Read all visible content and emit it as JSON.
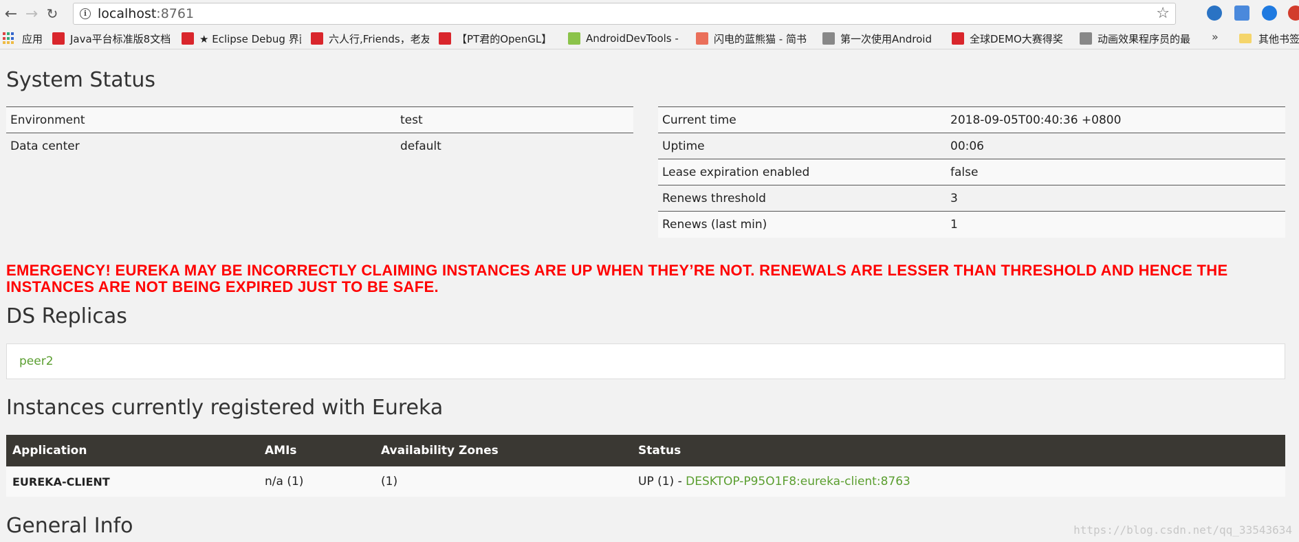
{
  "browser": {
    "url_host": "localhost",
    "url_port": ":8761",
    "bookmarks": [
      {
        "label": "应用",
        "color": ""
      },
      {
        "label": "Java平台标准版8文档",
        "color": "#d9262c"
      },
      {
        "label": "★ Eclipse Debug 界面",
        "color": "#d9262c"
      },
      {
        "label": "六人行,Friends，老友",
        "color": "#d9262c"
      },
      {
        "label": "【PT君的OpenGL】",
        "color": "#d9262c"
      },
      {
        "label": "AndroidDevTools -",
        "color": "#8bc34a"
      },
      {
        "label": "闪电的蓝熊猫 - 简书",
        "color": "#ea6f5a"
      },
      {
        "label": "第一次使用Android",
        "color": "#888888"
      },
      {
        "label": "全球DEMO大赛得奖",
        "color": "#d9262c"
      },
      {
        "label": "动画效果程序员的最",
        "color": "#888888"
      }
    ],
    "more_label": "»",
    "other_bookmarks": "其他书签"
  },
  "system_status": {
    "title": "System Status",
    "left": [
      {
        "key": "Environment",
        "value": "test"
      },
      {
        "key": "Data center",
        "value": "default"
      }
    ],
    "right": [
      {
        "key": "Current time",
        "value": "2018-09-05T00:40:36 +0800"
      },
      {
        "key": "Uptime",
        "value": "00:06"
      },
      {
        "key": "Lease expiration enabled",
        "value": "false"
      },
      {
        "key": "Renews threshold",
        "value": "3"
      },
      {
        "key": "Renews (last min)",
        "value": "1"
      }
    ]
  },
  "emergency": "EMERGENCY! EUREKA MAY BE INCORRECTLY CLAIMING INSTANCES ARE UP WHEN THEY’RE NOT. RENEWALS ARE LESSER THAN THRESHOLD AND HENCE THE INSTANCES ARE NOT BEING EXPIRED JUST TO BE SAFE.",
  "replicas": {
    "title": "DS Replicas",
    "items": [
      "peer2"
    ]
  },
  "instances": {
    "title": "Instances currently registered with Eureka",
    "headers": [
      "Application",
      "AMIs",
      "Availability Zones",
      "Status"
    ],
    "rows": [
      {
        "application": "EUREKA-CLIENT",
        "amis": "n/a (1)",
        "zones": "(1)",
        "status_prefix": "UP (1) - ",
        "status_link": "DESKTOP-P95O1F8:eureka-client:8763"
      }
    ]
  },
  "general_info": {
    "title": "General Info"
  },
  "watermark": "https://blog.csdn.net/qq_33543634",
  "colors": {
    "emergency": "#ff0000",
    "link": "#5a9e2f",
    "table_header": "#3a3833"
  }
}
